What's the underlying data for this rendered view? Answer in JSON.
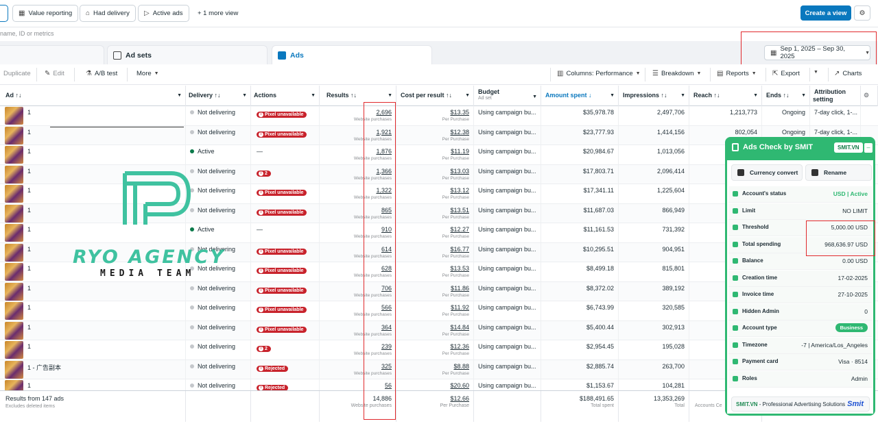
{
  "views": {
    "items": [
      {
        "label": "Value reporting",
        "icon": "value-icon"
      },
      {
        "label": "Had delivery",
        "icon": "delivery-icon"
      },
      {
        "label": "Active ads",
        "icon": "send-icon"
      }
    ],
    "more_view": "+ 1 more view",
    "create_view": "Create a view"
  },
  "search": {
    "placeholder": "name, ID or metrics"
  },
  "tabs": [
    {
      "label": ""
    },
    {
      "label": "Ad sets"
    },
    {
      "label": "Ads"
    }
  ],
  "date_range": "Sep 1, 2025 – Sep 30, 2025",
  "toolbar": {
    "duplicate": "Duplicate",
    "edit": "Edit",
    "ab_test": "A/B test",
    "more": "More",
    "columns": "Columns: Performance",
    "breakdown": "Breakdown",
    "reports": "Reports",
    "export": "Export",
    "charts": "Charts"
  },
  "columns": {
    "ad": "Ad ↑↓",
    "delivery": "Delivery ↑↓",
    "actions": "Actions",
    "results": "Results ↑↓",
    "cpr": "Cost per result ↑↓",
    "budget": "Budget",
    "budget_sub": "Ad set",
    "spent": "Amount spent ↓",
    "impressions": "Impressions ↑↓",
    "reach": "Reach ↑↓",
    "ends": "Ends ↑↓",
    "attribution": "Attribution setting"
  },
  "rows": [
    {
      "ad": "1",
      "delivery": "Not delivering",
      "active": false,
      "action": "Pixel unavailable",
      "results": "2,696",
      "cpr": "$13.35",
      "budget": "Using campaign bu...",
      "spent": "$35,978.78",
      "impressions": "2,497,706",
      "reach": "1,213,773",
      "ends": "Ongoing",
      "attr": "7-day click, 1-..."
    },
    {
      "ad": "1",
      "delivery": "Not delivering",
      "active": false,
      "action": "Pixel unavailable",
      "results": "1,921",
      "cpr": "$12.38",
      "budget": "Using campaign bu...",
      "spent": "$23,777.93",
      "impressions": "1,414,156",
      "reach": "802,054",
      "ends": "Ongoing",
      "attr": "7-day click, 1-..."
    },
    {
      "ad": "1",
      "delivery": "Active",
      "active": true,
      "action": "—",
      "results": "1,876",
      "cpr": "$11.19",
      "budget": "Using campaign bu...",
      "spent": "$20,984.67",
      "impressions": "1,013,056",
      "reach": "",
      "ends": "",
      "attr": ""
    },
    {
      "ad": "1",
      "delivery": "Not delivering",
      "active": false,
      "action": "2",
      "results": "1,366",
      "cpr": "$13.03",
      "budget": "Using campaign bu...",
      "spent": "$17,803.71",
      "impressions": "2,096,414",
      "reach": "",
      "ends": "",
      "attr": ""
    },
    {
      "ad": "1",
      "delivery": "Not delivering",
      "active": false,
      "action": "Pixel unavailable",
      "results": "1,322",
      "cpr": "$13.12",
      "budget": "Using campaign bu...",
      "spent": "$17,341.11",
      "impressions": "1,225,604",
      "reach": "",
      "ends": "",
      "attr": ""
    },
    {
      "ad": "1",
      "delivery": "Not delivering",
      "active": false,
      "action": "Pixel unavailable",
      "results": "865",
      "cpr": "$13.51",
      "budget": "Using campaign bu...",
      "spent": "$11,687.03",
      "impressions": "866,949",
      "reach": "",
      "ends": "",
      "attr": ""
    },
    {
      "ad": "1",
      "delivery": "Active",
      "active": true,
      "action": "—",
      "results": "910",
      "cpr": "$12.27",
      "budget": "Using campaign bu...",
      "spent": "$11,161.53",
      "impressions": "731,392",
      "reach": "",
      "ends": "",
      "attr": ""
    },
    {
      "ad": "1",
      "delivery": "Not delivering",
      "active": false,
      "action": "Pixel unavailable",
      "results": "614",
      "cpr": "$16.77",
      "budget": "Using campaign bu...",
      "spent": "$10,295.51",
      "impressions": "904,951",
      "reach": "",
      "ends": "",
      "attr": ""
    },
    {
      "ad": "1",
      "delivery": "Not delivering",
      "active": false,
      "action": "Pixel unavailable",
      "results": "628",
      "cpr": "$13.53",
      "budget": "Using campaign bu...",
      "spent": "$8,499.18",
      "impressions": "815,801",
      "reach": "",
      "ends": "",
      "attr": ""
    },
    {
      "ad": "1",
      "delivery": "Not delivering",
      "active": false,
      "action": "Pixel unavailable",
      "results": "706",
      "cpr": "$11.86",
      "budget": "Using campaign bu...",
      "spent": "$8,372.02",
      "impressions": "389,192",
      "reach": "",
      "ends": "",
      "attr": ""
    },
    {
      "ad": "1",
      "delivery": "Not delivering",
      "active": false,
      "action": "Pixel unavailable",
      "results": "566",
      "cpr": "$11.92",
      "budget": "Using campaign bu...",
      "spent": "$6,743.99",
      "impressions": "320,585",
      "reach": "",
      "ends": "",
      "attr": ""
    },
    {
      "ad": "1",
      "delivery": "Not delivering",
      "active": false,
      "action": "Pixel unavailable",
      "results": "364",
      "cpr": "$14.84",
      "budget": "Using campaign bu...",
      "spent": "$5,400.44",
      "impressions": "302,913",
      "reach": "",
      "ends": "",
      "attr": ""
    },
    {
      "ad": "1",
      "delivery": "Not delivering",
      "active": false,
      "action": "2",
      "results": "239",
      "cpr": "$12.36",
      "budget": "Using campaign bu...",
      "spent": "$2,954.45",
      "impressions": "195,028",
      "reach": "",
      "ends": "",
      "attr": ""
    },
    {
      "ad": "1 - 广告副本",
      "delivery": "Not delivering",
      "active": false,
      "action": "Rejected",
      "results": "325",
      "cpr": "$8.88",
      "budget": "Using campaign bu...",
      "spent": "$2,885.74",
      "impressions": "263,700",
      "reach": "",
      "ends": "",
      "attr": ""
    },
    {
      "ad": "1",
      "delivery": "Not delivering",
      "active": false,
      "action": "Rejected",
      "results": "56",
      "cpr": "$20.60",
      "budget": "Using campaign bu...",
      "spent": "$1,153.67",
      "impressions": "104,281",
      "reach": "",
      "ends": "",
      "attr": ""
    }
  ],
  "result_sub": "Website purchases",
  "cpr_sub": "Per Purchase",
  "footer": {
    "label": "Results from 147 ads",
    "sub": "Excludes deleted items",
    "results": "14,886",
    "results_sub": "Website purchases",
    "cpr": "$12.66",
    "cpr_sub": "Per Purchase",
    "spent": "$188,491.65",
    "spent_sub": "Total spent",
    "impressions": "13,353,269",
    "impressions_sub": "Total",
    "reach_sub": "Accounts Ce"
  },
  "watermark": {
    "title": "RYO AGENCY",
    "subtitle": "MEDIA TEAM"
  },
  "extension": {
    "title": "Ads Check by SMIT",
    "chip": "SMIT.VN",
    "buttons": {
      "currency": "Currency convert",
      "rename": "Rename"
    },
    "rows": [
      {
        "key": "Account's status",
        "value": "USD | Active"
      },
      {
        "key": "Limit",
        "value": "NO LIMIT"
      },
      {
        "key": "Threshold",
        "value": "5,000.00 USD"
      },
      {
        "key": "Total spending",
        "value": "968,636.97 USD"
      },
      {
        "key": "Balance",
        "value": "0.00 USD"
      },
      {
        "key": "Creation time",
        "value": "17-02-2025"
      },
      {
        "key": "Invoice time",
        "value": "27-10-2025"
      },
      {
        "key": "Hidden Admin",
        "value": "0"
      },
      {
        "key": "Account type",
        "value": "Business"
      },
      {
        "key": "Timezone",
        "value": "-7 | America/Los_Angeles"
      },
      {
        "key": "Payment card",
        "value": "Visa · 8514"
      },
      {
        "key": "Roles",
        "value": "Admin"
      }
    ],
    "footer_brand": "SMIT.VN",
    "footer_text": " - Professional Advertising Solutions",
    "footer_logo": "Smit"
  },
  "colors": {
    "primary": "#0a78be",
    "danger": "#c8232c",
    "ext_green": "#2fb872",
    "highlight": "#e0282b"
  }
}
